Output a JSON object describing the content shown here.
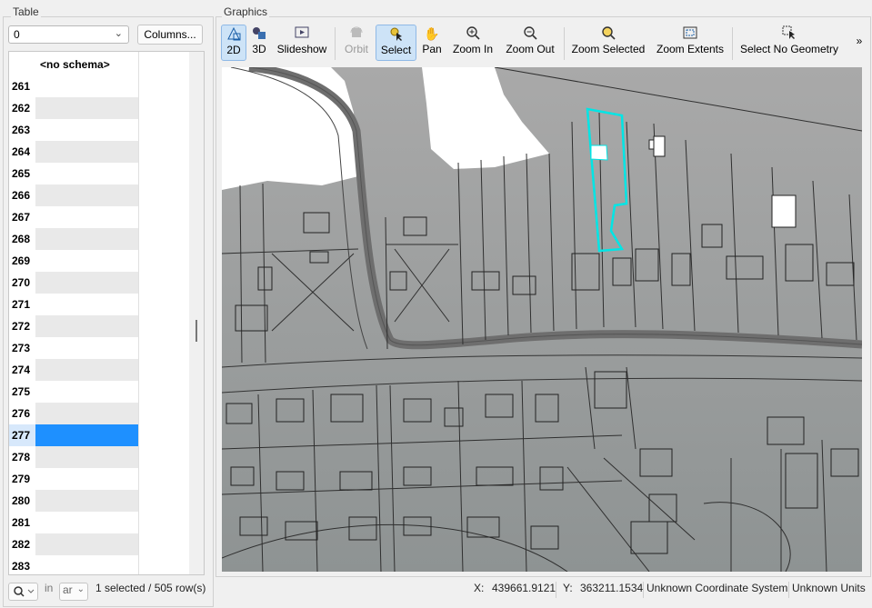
{
  "table": {
    "group_label": "Table",
    "combo_value": "0",
    "columns_button": "Columns...",
    "header": "<no schema>",
    "rows": [
      "261",
      "262",
      "263",
      "264",
      "265",
      "266",
      "267",
      "268",
      "269",
      "270",
      "271",
      "272",
      "273",
      "274",
      "275",
      "276",
      "277",
      "278",
      "279",
      "280",
      "281",
      "282",
      "283"
    ],
    "selected_row": "277",
    "search_in_label": "in",
    "search_field": "ar",
    "summary": "1 selected / 505 row(s)"
  },
  "graphics": {
    "group_label": "Graphics",
    "toolbar": {
      "btn_2d": "2D",
      "btn_3d": "3D",
      "slideshow": "Slideshow",
      "orbit": "Orbit",
      "select": "Select",
      "pan": "Pan",
      "zoom_in": "Zoom In",
      "zoom_out": "Zoom Out",
      "zoom_selected": "Zoom Selected",
      "zoom_extents": "Zoom Extents",
      "select_no_geometry": "Select No Geometry",
      "overflow": "»"
    },
    "selection_color": "#00e5e5"
  },
  "status": {
    "x_label": "X:",
    "x_value": "439661.9121",
    "y_label": "Y:",
    "y_value": "363211.1534",
    "coord_system": "Unknown Coordinate System",
    "units": "Unknown Units"
  },
  "icons": [
    "dropdown-chevron-icon",
    "search-icon",
    "shape-2d-icon",
    "shape-3d-icon",
    "slideshow-icon",
    "orbit-icon",
    "select-cursor-icon",
    "hand-pan-icon",
    "zoom-in-icon",
    "zoom-out-icon",
    "zoom-selected-icon",
    "zoom-extents-icon",
    "select-no-geometry-icon"
  ]
}
